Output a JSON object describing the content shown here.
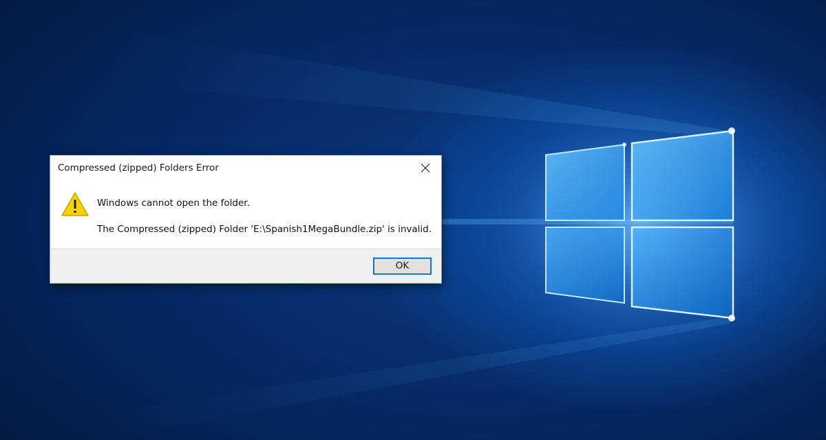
{
  "desktop": {
    "wallpaper": "windows-10-hero-logo",
    "colors": {
      "background": "#062a66",
      "glow": "#3fa9ff"
    }
  },
  "dialog": {
    "title": "Compressed (zipped) Folders Error",
    "close_icon": "close-icon",
    "warning_icon": "warning-icon",
    "message_main": "Windows cannot open the folder.",
    "message_detail": "The Compressed (zipped) Folder 'E:\\Spanish1MegaBundle.zip' is invalid.",
    "ok_label": "OK",
    "colors": {
      "accent": "#0078d7",
      "warning": "#f7d200"
    }
  }
}
